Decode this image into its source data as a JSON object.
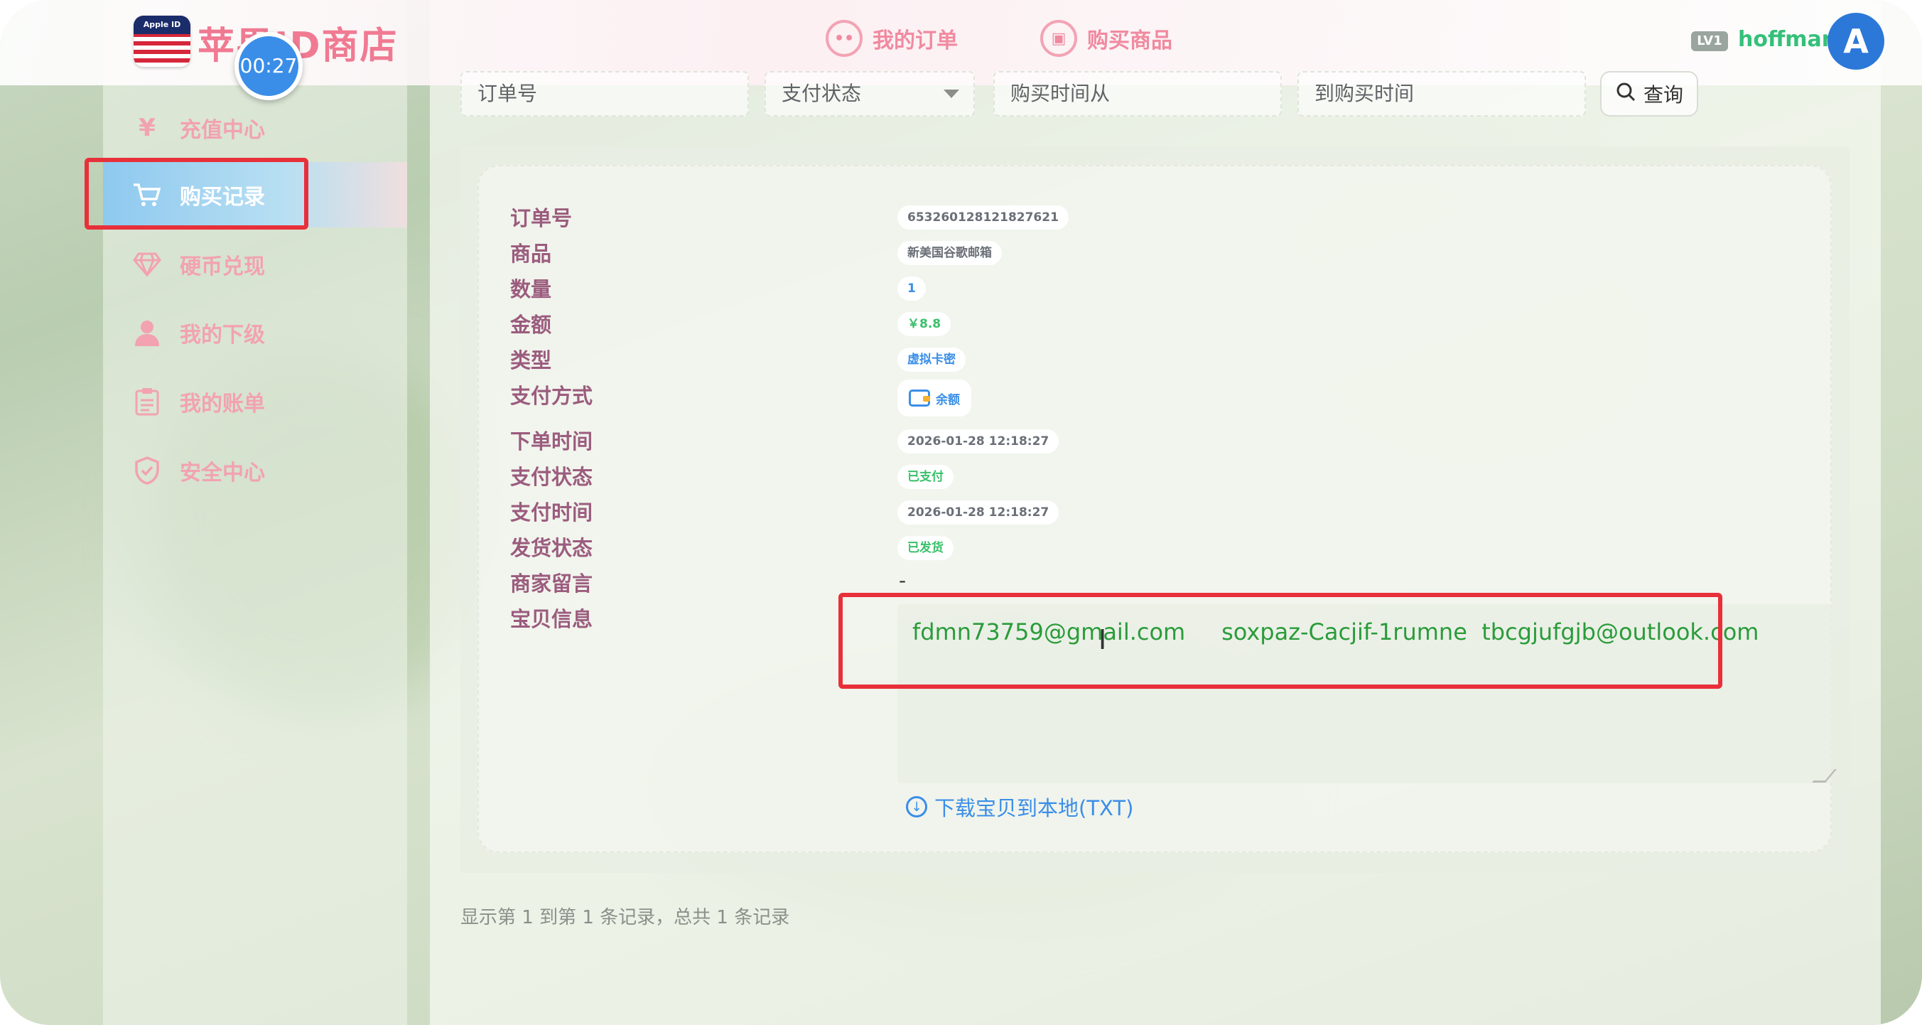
{
  "shop": {
    "title": "苹果ID商店",
    "flag_caption": "Apple ID",
    "timer": "00:27"
  },
  "header": {
    "nav": [
      {
        "label": "我的订单",
        "icon": "chat-icon"
      },
      {
        "label": "购买商品",
        "icon": "bag-icon"
      }
    ],
    "level": "LV1",
    "username": "hoffman",
    "avatar_text": "A"
  },
  "sidebar": {
    "items": [
      {
        "label": "充值中心",
        "icon": "yen-icon"
      },
      {
        "label": "购买记录",
        "icon": "cart-icon",
        "active": true
      },
      {
        "label": "硬币兑现",
        "icon": "diamond-icon"
      },
      {
        "label": "我的下级",
        "icon": "user-icon"
      },
      {
        "label": "我的账单",
        "icon": "clipboard-icon"
      },
      {
        "label": "安全中心",
        "icon": "shield-icon"
      }
    ]
  },
  "filters": {
    "order_no": "订单号",
    "pay_status": "支付状态",
    "time_from": "购买时间从",
    "time_to": "到购买时间",
    "query_button": "查询"
  },
  "order": {
    "labels": {
      "order_no": "订单号",
      "product": "商品",
      "quantity": "数量",
      "amount": "金额",
      "type": "类型",
      "pay_method": "支付方式",
      "order_time": "下单时间",
      "pay_status": "支付状态",
      "pay_time": "支付时间",
      "ship_status": "发货状态",
      "merchant_note": "商家留言",
      "item_info": "宝贝信息"
    },
    "values": {
      "order_no": "653260128121827621",
      "product": "新美国谷歌邮箱",
      "quantity": "1",
      "amount": "￥8.8",
      "type": "虚拟卡密",
      "pay_method": "余额",
      "order_time": "2026-01-28 12:18:27",
      "pay_status": "已支付",
      "pay_time": "2026-01-28 12:18:27",
      "ship_status": "已发货",
      "merchant_note": "-",
      "item_info": "fdmn73759@gmail.com     soxpaz-Cacjif-1rumne  tbcgjufgjb@outlook.com"
    },
    "download_link": "下载宝贝到本地(TXT)"
  },
  "footer": {
    "summary": "显示第 1 到第 1 条记录，总共 1 条记录"
  },
  "colors": {
    "accent_pink": "#f07a92",
    "accent_blue": "#3a8ee8",
    "success_green": "#3ac06a",
    "label_purple": "#9b5c7e"
  }
}
